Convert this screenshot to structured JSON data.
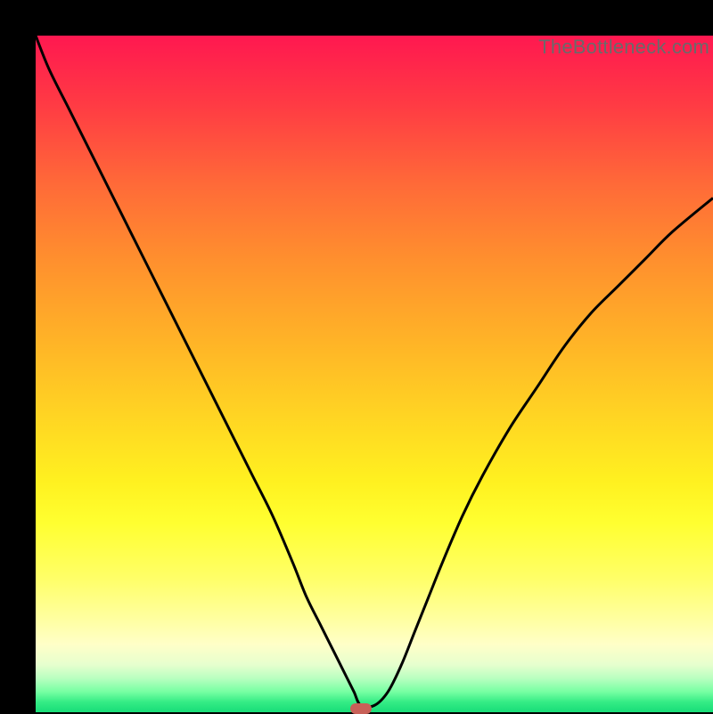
{
  "watermark": "TheBottleneck.com",
  "colors": {
    "frame": "#000000",
    "curve": "#000000",
    "marker": "#c86058",
    "gradient_top": "#ff1850",
    "gradient_bottom": "#18dd78"
  },
  "chart_data": {
    "type": "line",
    "title": "",
    "xlabel": "",
    "ylabel": "",
    "xlim": [
      0,
      100
    ],
    "ylim": [
      0,
      100
    ],
    "x": [
      0,
      2,
      5,
      8,
      11,
      14,
      17,
      20,
      23,
      26,
      29,
      32,
      35,
      38,
      40,
      42,
      44,
      46,
      47,
      48,
      50,
      52,
      54,
      56,
      58,
      60,
      63,
      66,
      70,
      74,
      78,
      82,
      86,
      90,
      94,
      100
    ],
    "y": [
      100,
      95,
      89,
      83,
      77,
      71,
      65,
      59,
      53,
      47,
      41,
      35,
      29,
      22,
      17,
      13,
      9,
      5,
      3,
      1,
      1,
      3,
      7,
      12,
      17,
      22,
      29,
      35,
      42,
      48,
      54,
      59,
      63,
      67,
      71,
      76
    ],
    "annotations": [
      {
        "type": "marker",
        "shape": "rounded-rect",
        "x": 48,
        "y": 0,
        "color": "#c86058"
      }
    ],
    "grid": false,
    "legend": false
  }
}
